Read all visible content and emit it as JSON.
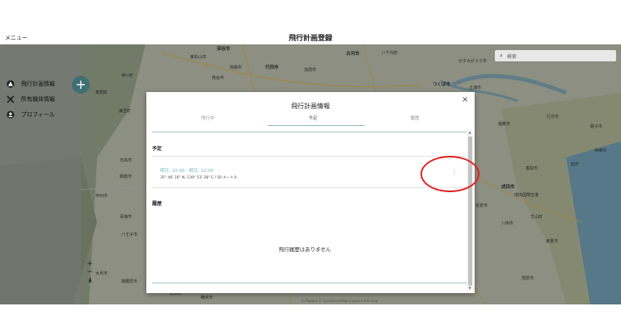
{
  "header": {
    "menu_label": "メニュー",
    "title": "飛行計画登録"
  },
  "sidebar": {
    "add_icon": "plus-icon",
    "items": [
      {
        "label": "飛行計画情報",
        "icon": "drone-triangle-icon"
      },
      {
        "label": "所有機体情報",
        "icon": "drone-x-icon"
      },
      {
        "label": "プロフィール",
        "icon": "person-icon"
      }
    ]
  },
  "map": {
    "search_placeholder": "検索",
    "zoom_in": "+",
    "zoom_out": "−",
    "attribution": "© Mapbox © OpenStreetMap Improve this map",
    "labels": [
      {
        "text": "深谷市",
        "city": true
      },
      {
        "text": "東松山市",
        "city": false
      },
      {
        "text": "鴻巣市",
        "city": false
      },
      {
        "text": "行田市",
        "city": true
      },
      {
        "text": "加須市",
        "city": false
      },
      {
        "text": "古河市",
        "city": true
      },
      {
        "text": "八千代町",
        "city": false
      },
      {
        "text": "かすみがうら市",
        "city": false
      },
      {
        "text": "神川町",
        "city": false
      },
      {
        "text": "熊谷市",
        "city": false
      },
      {
        "text": "つくば市",
        "city": true
      },
      {
        "text": "土浦市",
        "city": false
      },
      {
        "text": "寄居町",
        "city": false
      },
      {
        "text": "美里町",
        "city": false
      },
      {
        "text": "稲敷市",
        "city": false
      },
      {
        "text": "神栖市",
        "city": false
      },
      {
        "text": "成田市",
        "city": true
      },
      {
        "text": "佐倉市",
        "city": false
      },
      {
        "text": "八街市",
        "city": false
      },
      {
        "text": "芝山町",
        "city": false
      },
      {
        "text": "東金市",
        "city": false
      },
      {
        "text": "茂原市",
        "city": false
      },
      {
        "text": "日高市",
        "city": false
      },
      {
        "text": "飯能市",
        "city": false
      },
      {
        "text": "青梅市",
        "city": false
      },
      {
        "text": "八王子市",
        "city": false
      },
      {
        "text": "町田市",
        "city": false
      },
      {
        "text": "大月市",
        "city": false
      },
      {
        "text": "相模原市",
        "city": false
      },
      {
        "text": "甲州市",
        "city": false
      },
      {
        "text": "横浜市",
        "city": false
      },
      {
        "text": "行方市",
        "city": false
      },
      {
        "text": "銚子市",
        "city": false
      },
      {
        "text": "旭市",
        "city": false
      },
      {
        "text": "香取市",
        "city": false
      },
      {
        "text": "成田国際空港",
        "city": false
      }
    ]
  },
  "modal": {
    "title": "飛行計画情報",
    "close_label": "×",
    "tabs": [
      "飛行中",
      "予定",
      "履歴"
    ],
    "active_tab": "予定",
    "scheduled": {
      "heading": "予定",
      "items": [
        {
          "date": "明日, 10:00 - 明日, 12:00",
          "coords": "35° 46' 16\" N, 139° 53' 28\" E / 50 メートル"
        }
      ]
    },
    "history": {
      "heading": "履歴",
      "empty_message": "飛行履歴はありません"
    }
  },
  "colors": {
    "accent": "#6eb6c4",
    "fab": "#3d6f75",
    "annotation": "#e02020"
  }
}
